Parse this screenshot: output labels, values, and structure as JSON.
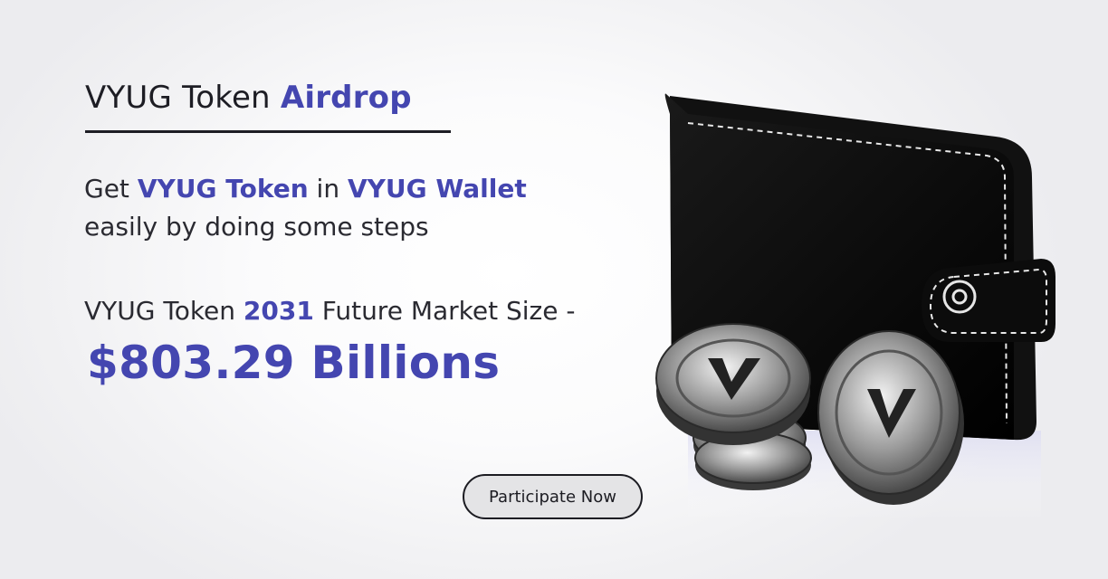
{
  "header": {
    "title_prefix": "VYUG Token",
    "title_accent": "Airdrop"
  },
  "intro": {
    "word_get": "Get",
    "token_name": "VYUG Token",
    "word_in": "in",
    "wallet_name": "VYUG Wallet",
    "line2": "easily by doing some steps"
  },
  "market": {
    "prefix": "VYUG Token",
    "year": "2031",
    "suffix": "Future Market Size -",
    "value": "$803.29 Billions"
  },
  "cta": {
    "label": "Participate Now"
  },
  "colors": {
    "accent": "#4446b0",
    "text": "#1d1d24",
    "button_bg": "#e4e4e6"
  },
  "illustration": {
    "icons": [
      "wallet-icon",
      "coin-icon"
    ]
  }
}
